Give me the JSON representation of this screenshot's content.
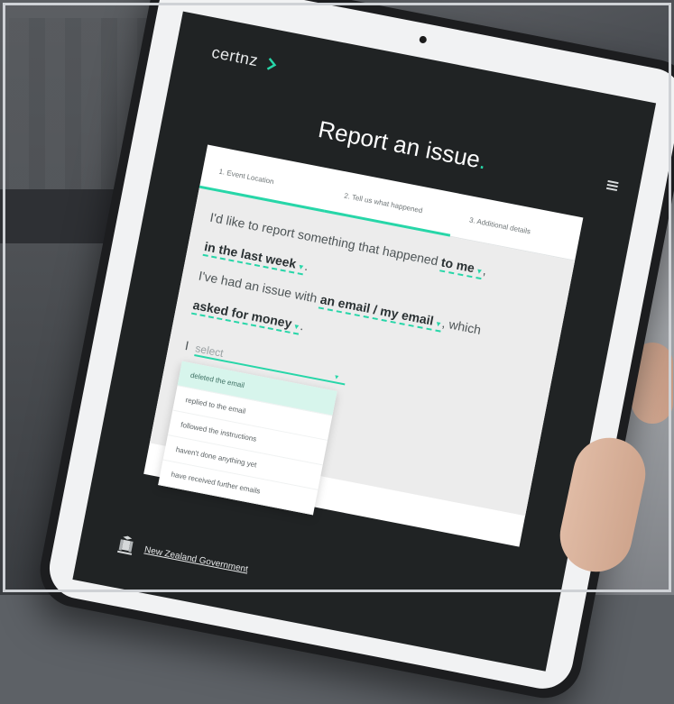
{
  "brand": {
    "name": "certnz",
    "accent": "#27d6a8"
  },
  "header": {
    "title": "Report an issue",
    "title_dot": "."
  },
  "steps": [
    {
      "label": "1. Event Location",
      "state": "done"
    },
    {
      "label": "2. Tell us what happened",
      "state": "active"
    },
    {
      "label": "3. Additional details",
      "state": "pending"
    }
  ],
  "form": {
    "line1_prefix": "I'd like to report something that happened",
    "who_value": "to me",
    "when_value": "in the last week",
    "line2_prefix": "I've had an issue with",
    "channel_value": "an email / my email",
    "line2_suffix": ", which",
    "what_value": "asked for money",
    "i_label": "I",
    "select_placeholder": "select"
  },
  "dropdown": {
    "options": [
      "deleted the email",
      "replied to the email",
      "followed the instructions",
      "haven't done anything yet",
      "have received further emails"
    ],
    "highlighted_index": 0
  },
  "footer": {
    "gov_label": "New Zealand Government"
  }
}
